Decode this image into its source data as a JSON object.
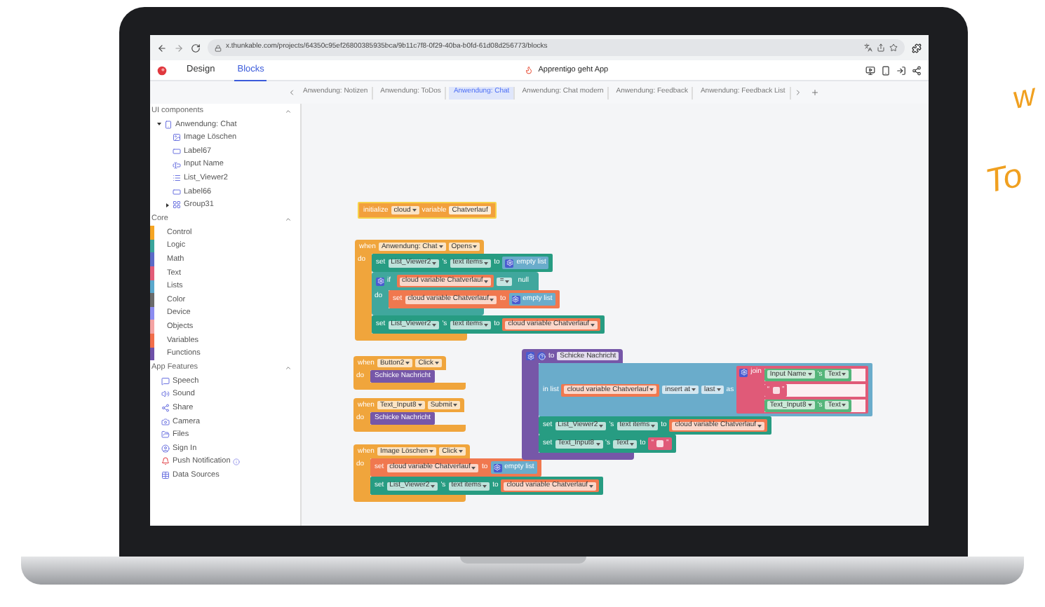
{
  "url": "x.thunkable.com/projects/64350c95ef26800385935bca/9b11c7f8-0f29-40ba-b0fd-61d08d256773/blocks",
  "app_tabs": [
    {
      "label": "Design",
      "selected": false
    },
    {
      "label": "Blocks",
      "selected": true
    }
  ],
  "project_title": "Apprentigo geht App",
  "screen_tabs": [
    {
      "label": "Anwendung: Notizen",
      "selected": false
    },
    {
      "label": "Anwendung: ToDos",
      "selected": false
    },
    {
      "label": "Anwendung: Chat",
      "selected": true
    },
    {
      "label": "Anwendung: Chat modern",
      "selected": false
    },
    {
      "label": "Anwendung: Feedback",
      "selected": false
    },
    {
      "label": "Anwendung: Feedback List",
      "selected": false
    }
  ],
  "sidebar": {
    "sections": [
      {
        "title": "UI components",
        "expanded": true,
        "kind": "tree",
        "items": [
          {
            "label": "Anwendung: Chat",
            "kind": "screen",
            "expanded": true,
            "children": [
              {
                "label": "Image Löschen",
                "kind": "image"
              },
              {
                "label": "Label67",
                "kind": "label"
              },
              {
                "label": "Input Name",
                "kind": "input"
              },
              {
                "label": "List_Viewer2",
                "kind": "list"
              },
              {
                "label": "Label66",
                "kind": "label"
              },
              {
                "label": "Group31",
                "kind": "group",
                "expanded": false
              }
            ]
          }
        ]
      },
      {
        "title": "Core",
        "expanded": true,
        "kind": "palette",
        "items": [
          {
            "label": "Control",
            "color": "#f5a524"
          },
          {
            "label": "Logic",
            "color": "#3aa59b"
          },
          {
            "label": "Math",
            "color": "#5b6bc7"
          },
          {
            "label": "Text",
            "color": "#e25c79"
          },
          {
            "label": "Lists",
            "color": "#5aa8cc"
          },
          {
            "label": "Color",
            "color": "#6b6b6b"
          },
          {
            "label": "Device",
            "color": "#8c8cf0"
          },
          {
            "label": "Objects",
            "color": "#f4a3a3"
          },
          {
            "label": "Variables",
            "color": "#f26d4a"
          },
          {
            "label": "Functions",
            "color": "#6e50a8"
          }
        ]
      },
      {
        "title": "App Features",
        "expanded": true,
        "kind": "features",
        "items": [
          {
            "label": "Speech",
            "kind": "speech"
          },
          {
            "label": "Sound",
            "kind": "sound"
          },
          {
            "label": "Share",
            "kind": "share"
          },
          {
            "label": "Camera",
            "kind": "camera"
          },
          {
            "label": "Files",
            "kind": "files"
          },
          {
            "label": "Sign In",
            "kind": "user"
          },
          {
            "label": "Push Notification",
            "kind": "notification",
            "info": true
          },
          {
            "label": "Data Sources",
            "kind": "table"
          }
        ]
      }
    ]
  },
  "blocks": [
    {
      "kind": "init",
      "tokens": [
        {
          "kind": "label",
          "text": "initialize"
        },
        {
          "kind": "dropdown",
          "text": "cloud"
        },
        {
          "kind": "label",
          "text": "variable"
        },
        {
          "kind": "field",
          "text": "Chatverlauf"
        }
      ]
    },
    {
      "kind": "event",
      "tokens": [
        {
          "kind": "label",
          "text": "when"
        },
        {
          "kind": "dropdown",
          "text": "Anwendung: Chat"
        },
        {
          "kind": "dropdown",
          "text": "Opens"
        }
      ],
      "do_label": "do",
      "body": [
        {
          "kind": "component",
          "tokens": [
            {
              "kind": "label",
              "text": "set"
            },
            {
              "kind": "dropdown",
              "text": "List_Viewer2"
            },
            {
              "kind": "label",
              "text": "'s"
            },
            {
              "kind": "dropdown",
              "text": "text items"
            },
            {
              "kind": "label",
              "text": "to"
            },
            {
              "kind": "list",
              "tokens": [
                {
                  "kind": "gear"
                },
                {
                  "kind": "label",
                  "text": "empty list"
                }
              ]
            }
          ]
        },
        {
          "kind": "logic",
          "tokens": [
            {
              "kind": "gear"
            },
            {
              "kind": "label",
              "text": "if"
            },
            {
              "kind": "logic",
              "tokens": [
                {
                  "kind": "variable",
                  "tokens": [
                    {
                      "kind": "dropdown",
                      "text": "cloud variable Chatverlauf"
                    }
                  ]
                },
                {
                  "kind": "dropdown",
                  "text": "="
                },
                {
                  "kind": "logic",
                  "tokens": [
                    {
                      "kind": "label",
                      "text": "null"
                    }
                  ]
                }
              ]
            }
          ],
          "do_label": "do",
          "body": [
            {
              "kind": "variable",
              "tokens": [
                {
                  "kind": "label",
                  "text": "set"
                },
                {
                  "kind": "dropdown",
                  "text": "cloud variable Chatverlauf"
                },
                {
                  "kind": "label",
                  "text": "to"
                },
                {
                  "kind": "list",
                  "tokens": [
                    {
                      "kind": "gear"
                    },
                    {
                      "kind": "label",
                      "text": "empty list"
                    }
                  ]
                }
              ]
            }
          ]
        },
        {
          "kind": "component",
          "tokens": [
            {
              "kind": "label",
              "text": "set"
            },
            {
              "kind": "dropdown",
              "text": "List_Viewer2"
            },
            {
              "kind": "label",
              "text": "'s"
            },
            {
              "kind": "dropdown",
              "text": "text items"
            },
            {
              "kind": "label",
              "text": "to"
            },
            {
              "kind": "variable",
              "tokens": [
                {
                  "kind": "dropdown",
                  "text": "cloud variable Chatverlauf"
                }
              ]
            }
          ]
        }
      ]
    },
    {
      "kind": "event",
      "tokens": [
        {
          "kind": "label",
          "text": "when"
        },
        {
          "kind": "dropdown",
          "text": "Button2"
        },
        {
          "kind": "dropdown",
          "text": "Click"
        }
      ],
      "do_label": "do",
      "body": [
        {
          "kind": "procedure",
          "tokens": [
            {
              "kind": "label",
              "text": "Schicke Nachricht"
            }
          ]
        }
      ]
    },
    {
      "kind": "event",
      "tokens": [
        {
          "kind": "label",
          "text": "when"
        },
        {
          "kind": "dropdown",
          "text": "Text_Input8"
        },
        {
          "kind": "dropdown",
          "text": "Submit"
        }
      ],
      "do_label": "do",
      "body": [
        {
          "kind": "procedure",
          "tokens": [
            {
              "kind": "label",
              "text": "Schicke Nachricht"
            }
          ]
        }
      ]
    },
    {
      "kind": "event",
      "tokens": [
        {
          "kind": "label",
          "text": "when"
        },
        {
          "kind": "dropdown",
          "text": "Image Löschen"
        },
        {
          "kind": "dropdown",
          "text": "Click"
        }
      ],
      "do_label": "do",
      "body": [
        {
          "kind": "variable",
          "tokens": [
            {
              "kind": "label",
              "text": "set"
            },
            {
              "kind": "dropdown",
              "text": "cloud variable Chatverlauf"
            },
            {
              "kind": "label",
              "text": "to"
            },
            {
              "kind": "list",
              "tokens": [
                {
                  "kind": "gear"
                },
                {
                  "kind": "label",
                  "text": "empty list"
                }
              ]
            }
          ]
        },
        {
          "kind": "component",
          "tokens": [
            {
              "kind": "label",
              "text": "set"
            },
            {
              "kind": "dropdown",
              "text": "List_Viewer2"
            },
            {
              "kind": "label",
              "text": "'s"
            },
            {
              "kind": "dropdown",
              "text": "text items"
            },
            {
              "kind": "label",
              "text": "to"
            },
            {
              "kind": "variable",
              "tokens": [
                {
                  "kind": "dropdown",
                  "text": "cloud variable Chatverlauf"
                }
              ]
            }
          ]
        }
      ]
    },
    {
      "kind": "procedure",
      "tokens": [
        {
          "kind": "gear"
        },
        {
          "kind": "help"
        },
        {
          "kind": "label",
          "text": "to"
        },
        {
          "kind": "field",
          "text": "Schicke Nachricht"
        }
      ],
      "body": [
        {
          "kind": "list",
          "tokens": [
            {
              "kind": "label",
              "text": "in list"
            },
            {
              "kind": "variable",
              "tokens": [
                {
                  "kind": "dropdown",
                  "text": "cloud variable Chatverlauf"
                }
              ]
            },
            {
              "kind": "dropdown",
              "text": "insert at"
            },
            {
              "kind": "dropdown",
              "text": "last"
            },
            {
              "kind": "label",
              "text": "as"
            },
            {
              "kind": "text",
              "tokens": [
                {
                  "kind": "gear"
                },
                {
                  "kind": "label",
                  "text": "join"
                }
              ],
              "inputs": [
                [
                  {
                    "kind": "getter",
                    "tokens": [
                      {
                        "kind": "dropdown",
                        "text": "Input Name"
                      },
                      {
                        "kind": "label",
                        "text": "'s"
                      },
                      {
                        "kind": "dropdown",
                        "text": "Text"
                      }
                    ]
                  }
                ],
                [
                  {
                    "kind": "text",
                    "tokens": [
                      {
                        "kind": "label",
                        "text": "“"
                      },
                      {
                        "kind": "blank"
                      },
                      {
                        "kind": "label",
                        "text": "”"
                      }
                    ]
                  }
                ],
                [
                  {
                    "kind": "getter",
                    "tokens": [
                      {
                        "kind": "dropdown",
                        "text": "Text_Input8"
                      },
                      {
                        "kind": "label",
                        "text": "'s"
                      },
                      {
                        "kind": "dropdown",
                        "text": "Text"
                      }
                    ]
                  }
                ]
              ]
            }
          ]
        },
        {
          "kind": "component",
          "tokens": [
            {
              "kind": "label",
              "text": "set"
            },
            {
              "kind": "dropdown",
              "text": "List_Viewer2"
            },
            {
              "kind": "label",
              "text": "'s"
            },
            {
              "kind": "dropdown",
              "text": "text items"
            },
            {
              "kind": "label",
              "text": "to"
            },
            {
              "kind": "variable",
              "tokens": [
                {
                  "kind": "dropdown",
                  "text": "cloud variable Chatverlauf"
                }
              ]
            }
          ]
        },
        {
          "kind": "component",
          "tokens": [
            {
              "kind": "label",
              "text": "set"
            },
            {
              "kind": "dropdown",
              "text": "Text_Input8"
            },
            {
              "kind": "label",
              "text": "'s"
            },
            {
              "kind": "dropdown",
              "text": "Text"
            },
            {
              "kind": "label",
              "text": "to"
            },
            {
              "kind": "text",
              "tokens": [
                {
                  "kind": "label",
                  "text": "“"
                },
                {
                  "kind": "blank"
                },
                {
                  "kind": "label",
                  "text": "”"
                }
              ]
            }
          ]
        }
      ]
    }
  ],
  "side_notes": [
    "w",
    "To"
  ]
}
